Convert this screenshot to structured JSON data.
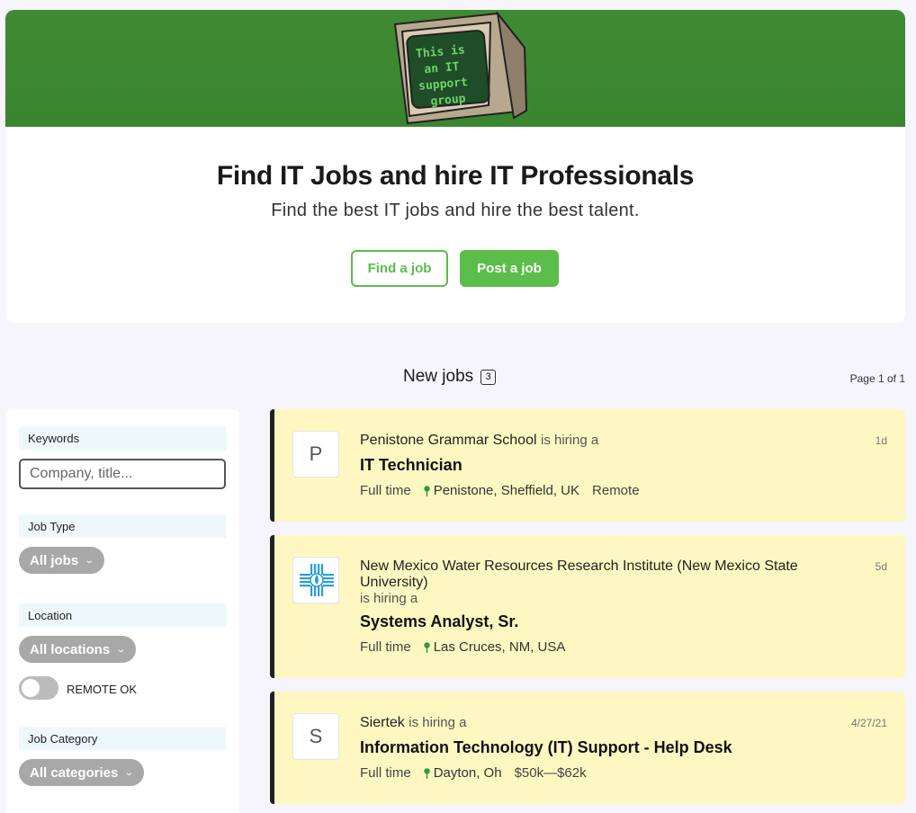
{
  "hero": {
    "banner_text": "This is an IT support group",
    "title": "Find IT Jobs and hire IT Professionals",
    "subtitle": "Find the best IT jobs and hire the best talent.",
    "find_label": "Find a job",
    "post_label": "Post a job"
  },
  "listing": {
    "title": "New jobs",
    "count": "3",
    "page": "Page 1 of 1"
  },
  "filters": {
    "keywords_label": "Keywords",
    "keywords_placeholder": "Company, title...",
    "job_type_label": "Job Type",
    "job_type_value": "All jobs",
    "location_label": "Location",
    "location_value": "All locations",
    "remote_label": "REMOTE OK",
    "category_label": "Job Category",
    "category_value": "All categories"
  },
  "jobs": [
    {
      "logo": "P",
      "company": "Penistone Grammar School",
      "hiring": "is hiring a",
      "title": "IT Technician",
      "type": "Full time",
      "location": "Penistone, Sheffield, UK",
      "extra": "Remote",
      "when": "1d"
    },
    {
      "logo": "",
      "company": "New Mexico Water Resources Research Institute (New Mexico State University)",
      "hiring": "is hiring a",
      "title": "Systems Analyst, Sr.",
      "type": "Full time",
      "location": "Las Cruces, NM, USA",
      "extra": "",
      "when": "5d"
    },
    {
      "logo": "S",
      "company": "Siertek",
      "hiring": "is hiring a",
      "title": "Information Technology (IT) Support - Help Desk",
      "type": "Full time",
      "location": "Dayton, Oh",
      "extra": "$50k—$62k",
      "when": "4/27/21"
    }
  ],
  "colors": {
    "brand_green": "#5bbd4a",
    "banner_green": "#3f8a32",
    "job_card": "#fff7c2"
  },
  "icons": [
    "monitor-logo-icon",
    "chevron-down-icon",
    "location-pin-icon",
    "zia-water-logo-icon"
  ]
}
